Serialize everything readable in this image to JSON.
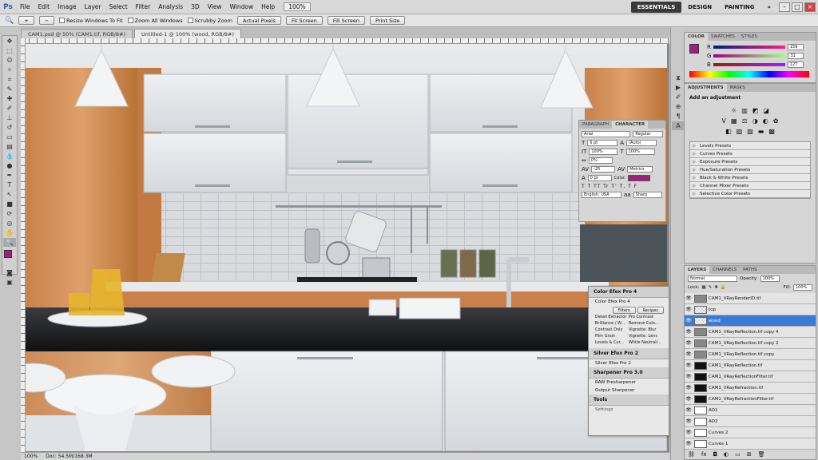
{
  "menubar": {
    "logo": "Ps",
    "items": [
      "File",
      "Edit",
      "Image",
      "Layer",
      "Select",
      "Filter",
      "Analysis",
      "3D",
      "View",
      "Window",
      "Help"
    ],
    "zoom": "100%",
    "workspaces": [
      "ESSENTIALS",
      "DESIGN",
      "PAINTING"
    ],
    "more": "»"
  },
  "options": {
    "resize_windows": "Resize Windows To Fit",
    "zoom_all": "Zoom All Windows",
    "scrubby_zoom": "Scrubby Zoom",
    "actual_pixels": "Actual Pixels",
    "fit_screen": "Fit Screen",
    "fill_screen": "Fill Screen",
    "print_size": "Print Size"
  },
  "tabs": [
    "CAM1.psd @ 50% (CAM1.tif, RGB/8#)",
    "Untitled-1 @ 100% (wood, RGB/8#)"
  ],
  "status": {
    "zoom": "100%",
    "doc": "Doc: 54.5M/168.3M"
  },
  "color_panel": {
    "tabs": [
      "COLOR",
      "SWATCHES",
      "STYLES"
    ],
    "r": "159",
    "g": "31",
    "b": "127",
    "labels": [
      "R",
      "G",
      "B"
    ]
  },
  "adjustments": {
    "tabs": [
      "ADJUSTMENTS",
      "MASKS"
    ],
    "title": "Add an adjustment",
    "presets": [
      "Levels Presets",
      "Curves Presets",
      "Exposure Presets",
      "Hue/Saturation Presets",
      "Black & White Presets",
      "Channel Mixer Presets",
      "Selective Color Presets"
    ]
  },
  "character": {
    "tabs": [
      "PARAGRAPH",
      "CHARACTER"
    ],
    "font": "Arial",
    "style": "Regular",
    "size": "6 pt",
    "leading": "(Auto)",
    "vscale": "100%",
    "hscale": "100%",
    "tracking": "0%",
    "kerning": "-25",
    "metrics": "Metrics",
    "baseline": "0 pt",
    "color_label": "Color:",
    "language": "English: USA",
    "aa": "Sharp",
    "glyphs": "T T TT Tr T' T, T F"
  },
  "efex": {
    "cep4": "Color Efex Pro 4",
    "cep4_sub": "Color Efex Pro 4",
    "filters_tab": "Filters",
    "recipes_tab": "Recipes",
    "filters": [
      "Detail Extractor",
      "Pro Contrast",
      "Brilliance / W...",
      "Remove Colo...",
      "Contrast Only",
      "Vignette: Blur",
      "Film Grain",
      "Vignette: Lens",
      "Levels & Cur...",
      "White Neutrali..."
    ],
    "sep2": "Silver Efex Pro 2",
    "sep2_sub": "Silver Efex Pro 2",
    "sharp": "Sharpener Pro 3.0",
    "raw": "RAW Presharpener",
    "output": "Output Sharpener",
    "tools": "Tools",
    "settings": "Settings"
  },
  "layers": {
    "tabs": [
      "LAYERS",
      "CHANNELS",
      "PATHS"
    ],
    "blend": "Normal",
    "opacity_label": "Opacity:",
    "opacity": "100%",
    "lock_label": "Lock:",
    "fill_label": "Fill:",
    "fill": "100%",
    "rows": [
      {
        "name": "CAM1_VRayRenderID.tif",
        "thumb": "img"
      },
      {
        "name": "top",
        "thumb": "check"
      },
      {
        "name": "wood",
        "thumb": "check",
        "selected": true
      },
      {
        "name": "CAM1_VRayReflection.tif copy 4",
        "thumb": "img"
      },
      {
        "name": "CAM1_VRayReflection.tif copy 2",
        "thumb": "img"
      },
      {
        "name": "CAM1_VRayReflection.tif copy",
        "thumb": "img"
      },
      {
        "name": "CAM1_VRayReflection.tif",
        "thumb": "black"
      },
      {
        "name": "CAM1_VRayReflectionFilter.tif",
        "thumb": "black"
      },
      {
        "name": "CAM1_VRayRefraction.tif",
        "thumb": "black"
      },
      {
        "name": "CAM1_VRayRefractionFilter.tif",
        "thumb": "black"
      },
      {
        "name": "AO1",
        "thumb": "white"
      },
      {
        "name": "AO2",
        "thumb": "white"
      },
      {
        "name": "Curves 2",
        "thumb": "white"
      },
      {
        "name": "Curves 1",
        "thumb": "white"
      }
    ]
  },
  "colors": {
    "accent": "#3b7bd6",
    "fg_swatch": "#9f1f7f"
  }
}
